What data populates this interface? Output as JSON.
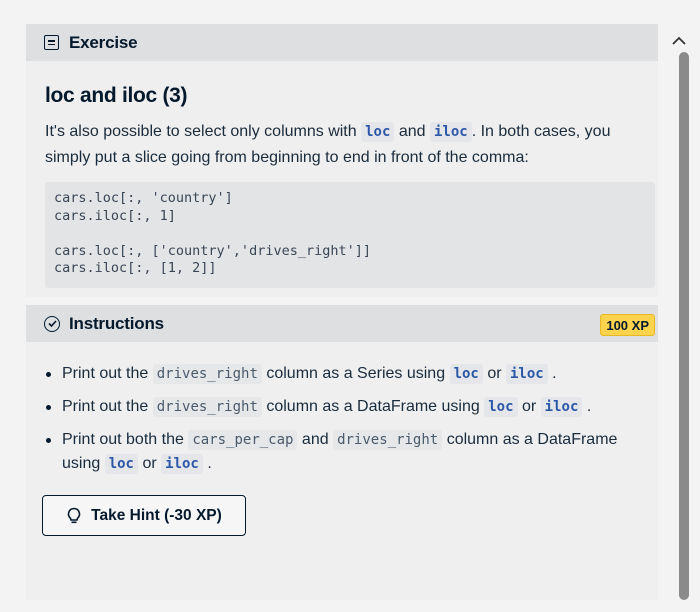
{
  "exercise": {
    "header_label": "Exercise",
    "title": "loc and iloc (3)",
    "intro": {
      "part1": "It's also possible to select only columns with",
      "code1": "loc",
      "part2": "and",
      "code2": "iloc",
      "part3": ". In both cases, you simply put a slice going from beginning to end in front of the comma:"
    },
    "code_block": "cars.loc[:, 'country']\ncars.iloc[:, 1]\n\ncars.loc[:, ['country','drives_right']]\ncars.iloc[:, [1, 2]]"
  },
  "instructions": {
    "header_label": "Instructions",
    "xp_badge": "100 XP",
    "items": [
      {
        "t1": "Print out the",
        "c1": "drives_right",
        "t2": "column as a Series using",
        "c2": "loc",
        "t3": "or",
        "c3": "iloc",
        "t4": "."
      },
      {
        "t1": "Print out the",
        "c1": "drives_right",
        "t2": "column as a DataFrame using",
        "c2": "loc",
        "t3": "or",
        "c3": "iloc",
        "t4": "."
      },
      {
        "t1": "Print out both the",
        "c1": "cars_per_cap",
        "t2": "and",
        "c2": "drives_right",
        "t3": "column as a DataFrame using",
        "c3": "loc",
        "t4": "or",
        "c4": "iloc",
        "t5": "."
      }
    ],
    "hint_button": "Take Hint (-30 XP)"
  },
  "icons": {
    "exercise": "document-icon",
    "instructions": "check-circle-icon",
    "hint": "lightbulb-icon",
    "collapse": "chevron-up-icon"
  },
  "colors": {
    "badge": "#fcd34d",
    "inline_code_text": "#2b57a8",
    "header_bg": "#dedfe0"
  }
}
